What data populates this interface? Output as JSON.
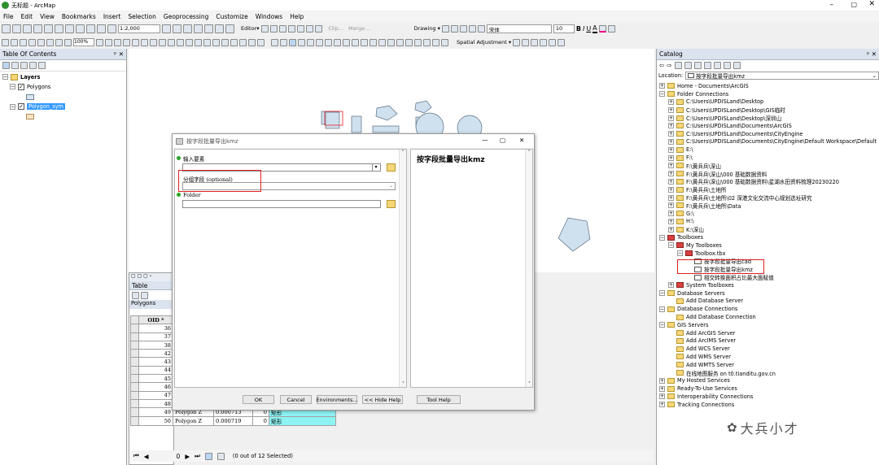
{
  "app": {
    "title": "无标题 - ArcMap"
  },
  "menu": [
    "File",
    "Edit",
    "View",
    "Bookmarks",
    "Insert",
    "Selection",
    "Geoprocessing",
    "Customize",
    "Windows",
    "Help"
  ],
  "toolbar": {
    "scale": "1:2,000",
    "editor": "Editor▾",
    "clip": "Clip...",
    "merge": "Merge...",
    "drawing": "Drawing ▾",
    "font": "宋体",
    "font_size": "10",
    "zoom": "100%",
    "spatial_adjustment": "Spatial Adjustment ▾"
  },
  "toc": {
    "title": "Table Of Contents",
    "layers": "Layers",
    "items": [
      "Polygons",
      "Polygon_sym"
    ]
  },
  "dialog": {
    "title": "按字段批量导出kmz",
    "input_label": "输入要素",
    "group_label": "分组字段 (optional)",
    "folder_label": "Folder",
    "help_title": "按字段批量导出kmz",
    "buttons": {
      "ok": "OK",
      "cancel": "Cancel",
      "environments": "Environments...",
      "hide_help": "<< Hide Help",
      "tool_help": "Tool Help"
    }
  },
  "table": {
    "title": "Table",
    "layer": "Polygons",
    "col": "OID *",
    "rows": [
      [
        "36"
      ],
      [
        "37"
      ],
      [
        "38"
      ],
      [
        "42"
      ],
      [
        "43"
      ],
      [
        "44"
      ],
      [
        "45"
      ],
      [
        "46"
      ],
      [
        "47"
      ],
      [
        "48"
      ],
      [
        "49",
        "Polygon Z",
        "0.000713",
        "0",
        "矩形"
      ],
      [
        "50",
        "Polygon Z",
        "0.000719",
        "0",
        "矩形"
      ]
    ],
    "page": "0",
    "status": "(0 out of 12 Selected)"
  },
  "catalog": {
    "title": "Catalog",
    "location_label": "Location:",
    "location": "按字段批量导出kmz",
    "items": [
      {
        "t": "Home - Documents\\ArcGIS",
        "l": 0,
        "e": "+"
      },
      {
        "t": "Folder Connections",
        "l": 0,
        "e": "-"
      },
      {
        "t": "C:\\Users\\UPDISLand\\Desktop",
        "l": 1,
        "e": "+"
      },
      {
        "t": "C:\\Users\\UPDISLand\\Desktop\\GIS临时",
        "l": 1,
        "e": "+"
      },
      {
        "t": "C:\\Users\\UPDISLand\\Desktop\\深圳山",
        "l": 1,
        "e": "+"
      },
      {
        "t": "C:\\Users\\UPDISLand\\Documents\\ArcGIS",
        "l": 1,
        "e": "+"
      },
      {
        "t": "C:\\Users\\UPDISLand\\Documents\\CityEngine",
        "l": 1,
        "e": "+"
      },
      {
        "t": "C:\\Users\\UPDISLand\\Documents\\CityEngine\\Default Workspace\\Default",
        "l": 1,
        "e": "+"
      },
      {
        "t": "E:\\",
        "l": 1,
        "e": "+"
      },
      {
        "t": "F:\\",
        "l": 1,
        "e": "+"
      },
      {
        "t": "F:\\黄兵兵\\深山",
        "l": 1,
        "e": "+"
      },
      {
        "t": "F:\\黄兵兵\\深山\\000 基础数据资料",
        "l": 1,
        "e": "+"
      },
      {
        "t": "F:\\黄兵兵\\深山\\000 基础数据资料\\星湖水田资料梳理20230220",
        "l": 1,
        "e": "+"
      },
      {
        "t": "F:\\黄兵兵\\土地所",
        "l": 1,
        "e": "+"
      },
      {
        "t": "F:\\黄兵兵\\土地所\\02 深港文化交流中心规划选址研究",
        "l": 1,
        "e": "+"
      },
      {
        "t": "F:\\黄兵兵\\土地所\\Data",
        "l": 1,
        "e": "+"
      },
      {
        "t": "G:\\",
        "l": 1,
        "e": "+"
      },
      {
        "t": "H:\\",
        "l": 1,
        "e": "+"
      },
      {
        "t": "K:\\深山",
        "l": 1,
        "e": "+"
      },
      {
        "t": "Toolboxes",
        "l": 0,
        "e": "-"
      },
      {
        "t": "My Toolboxes",
        "l": 1,
        "e": "-"
      },
      {
        "t": "Toolbox.tbx",
        "l": 2,
        "e": "-"
      },
      {
        "t": "按字段批量导出cad",
        "l": 3,
        "e": ""
      },
      {
        "t": "按字段批量导出kmz",
        "l": 3,
        "e": ""
      },
      {
        "t": "相交转换面积占比最大面赋值",
        "l": 3,
        "e": ""
      },
      {
        "t": "System Toolboxes",
        "l": 1,
        "e": "+"
      },
      {
        "t": "Database Servers",
        "l": 0,
        "e": "-"
      },
      {
        "t": "Add Database Server",
        "l": 1,
        "e": ""
      },
      {
        "t": "Database Connections",
        "l": 0,
        "e": "-"
      },
      {
        "t": "Add Database Connection",
        "l": 1,
        "e": ""
      },
      {
        "t": "GIS Servers",
        "l": 0,
        "e": "-"
      },
      {
        "t": "Add ArcGIS Server",
        "l": 1,
        "e": ""
      },
      {
        "t": "Add ArcIMS Server",
        "l": 1,
        "e": ""
      },
      {
        "t": "Add WCS Server",
        "l": 1,
        "e": ""
      },
      {
        "t": "Add WMS Server",
        "l": 1,
        "e": ""
      },
      {
        "t": "Add WMTS Server",
        "l": 1,
        "e": ""
      },
      {
        "t": "在线地图服务 on t0.tianditu.gov.cn",
        "l": 1,
        "e": ""
      },
      {
        "t": "My Hosted Services",
        "l": 0,
        "e": "+"
      },
      {
        "t": "Ready-To-Use Services",
        "l": 0,
        "e": "+"
      },
      {
        "t": "Interoperability Connections",
        "l": 0,
        "e": "+"
      },
      {
        "t": "Tracking Connections",
        "l": 0,
        "e": "+"
      }
    ]
  },
  "watermark": "大兵小才",
  "colors": {
    "highlight": "#3399ff",
    "red_box": "#e02020",
    "polygon_fill": "#cfe0ee",
    "header_bg": "#dbe3ee",
    "cell_highlight": "#8ef3f3"
  }
}
